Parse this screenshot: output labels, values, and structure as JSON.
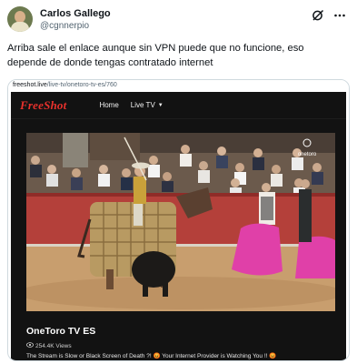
{
  "author": {
    "name": "Carlos Gallego",
    "handle": "@cgnnerpio"
  },
  "tweet": {
    "text": "Arriba sale el enlace aunque sin VPN puede que no funcione, eso depende de donde tengas contratado internet"
  },
  "card": {
    "domain": "freeshot.live",
    "path": "/live-tv/onetoro-tv-es/760"
  },
  "site": {
    "logo": "FreeShot",
    "nav": [
      {
        "label": "Home"
      },
      {
        "label": "Live TV"
      }
    ],
    "video_title": "OneToro TV ES",
    "views": "254.4K Views",
    "notice": "The Stream is Slow or Black Screen of Death ?! 😡 Your Internet Provider is Watching You !! 😡",
    "watermark": "onetoro"
  },
  "colors": {
    "logo": "#e8312c",
    "site_bg": "#121212",
    "capote": "#e040a8",
    "handle": "#536471"
  },
  "icons": [
    "avatar",
    "grok-icon",
    "more-icon",
    "chevron-down-icon",
    "eye-icon"
  ]
}
